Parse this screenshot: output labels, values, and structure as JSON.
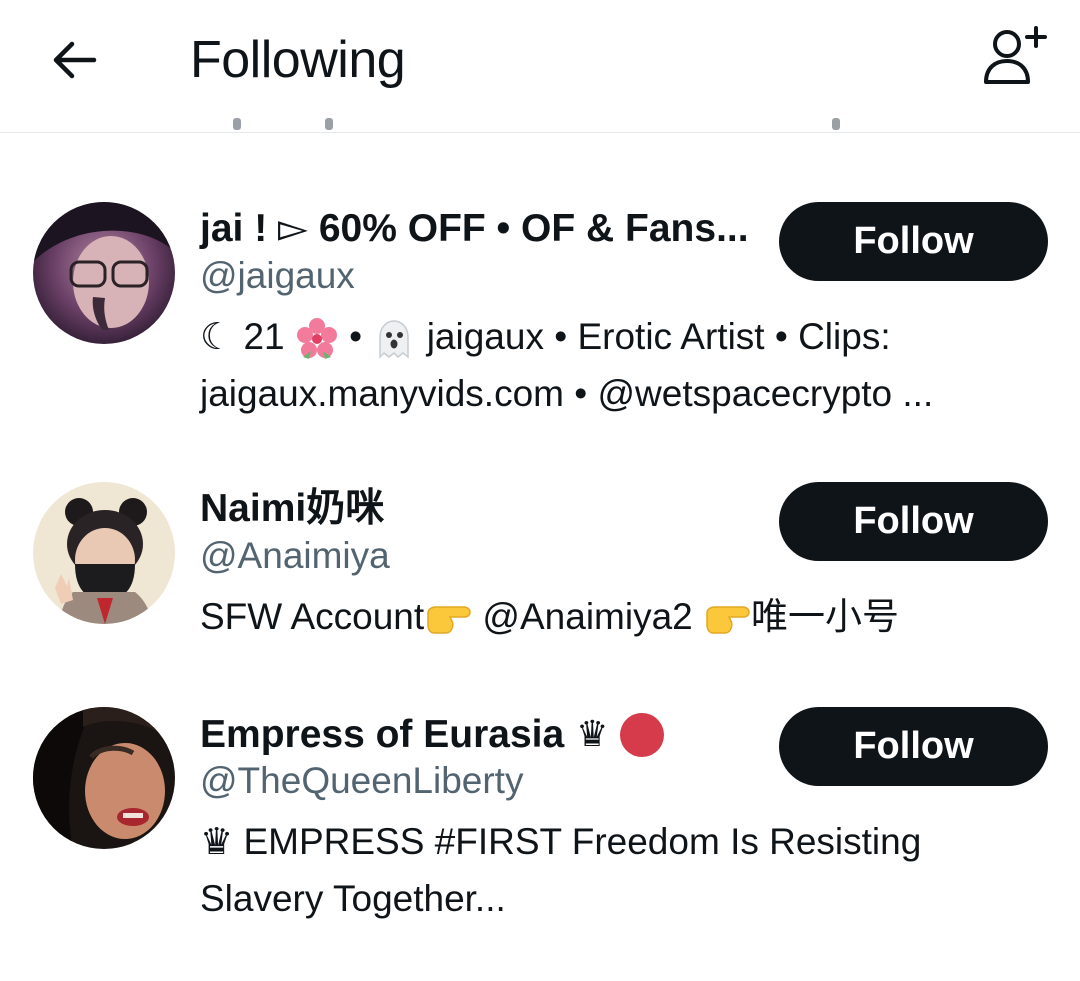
{
  "header": {
    "title": "Following",
    "back_icon": "arrow-left-icon",
    "add_user_icon": "add-user-icon"
  },
  "users": [
    {
      "name": "jai ! ▻ 60% OFF • OF & Fans...",
      "handle": "@jaigaux",
      "follow_label": "Follow",
      "bio_line1_a": "☾ 21",
      "bio_line1_b": "•",
      "bio_line1_c": "jaigaux • Erotic Artist • Clips:",
      "bio_line2": "jaigaux.manyvids.com • @wetspacecrypto ...",
      "bio_icons": [
        "hibiscus-icon",
        "ghost-icon"
      ]
    },
    {
      "name": "Naimi奶咪",
      "handle": "@Anaimiya",
      "follow_label": "Follow",
      "bio_a": "SFW Account",
      "bio_b": "@Anaimiya2",
      "bio_c": "唯一小号",
      "bio_icons": [
        "pointing-right-icon",
        "pointing-right-icon"
      ]
    },
    {
      "name": "Empress of Eurasia",
      "name_crown": "♛",
      "handle": "@TheQueenLiberty",
      "follow_label": "Follow",
      "bio_line1": "♛ EMPRESS #FIRST Freedom Is Resisting",
      "bio_line2": "Slavery Together...",
      "name_icons": [
        "crown-icon",
        "red-circle-icon"
      ]
    }
  ],
  "colors": {
    "text": "#0f1419",
    "secondary": "#536471",
    "button": "#0f1419",
    "divider": "#e6e9ea",
    "red_circle": "#d53b4a"
  }
}
